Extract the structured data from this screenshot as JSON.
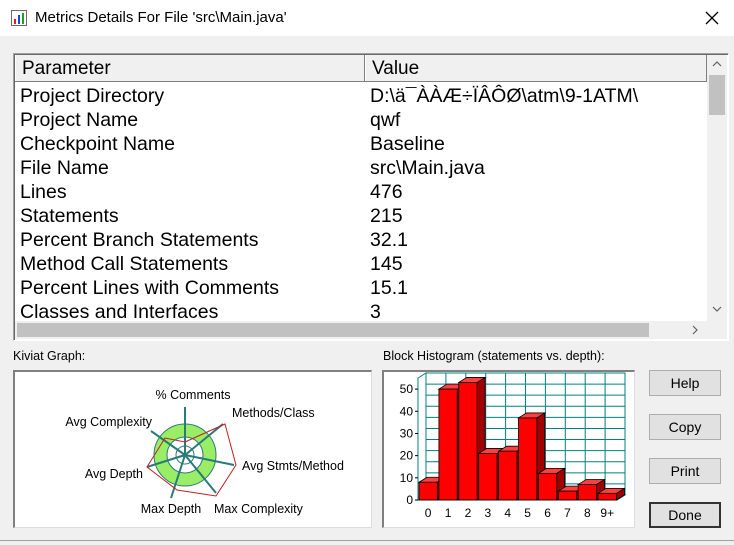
{
  "window": {
    "title": "Metrics Details For File 'src\\Main.java'",
    "close_icon": "close-icon"
  },
  "table": {
    "headers": [
      "Parameter",
      "Value"
    ],
    "rows": [
      {
        "param": "Project Directory",
        "value": "D:\\ä¯ÀÀÆ÷ÏÂÔØ\\atm\\9-1ATM\\"
      },
      {
        "param": "Project Name",
        "value": "qwf"
      },
      {
        "param": "Checkpoint Name",
        "value": "Baseline"
      },
      {
        "param": "File Name",
        "value": "src\\Main.java"
      },
      {
        "param": "Lines",
        "value": "476"
      },
      {
        "param": "Statements",
        "value": "215"
      },
      {
        "param": "Percent Branch Statements",
        "value": "32.1"
      },
      {
        "param": "Method Call Statements",
        "value": "145"
      },
      {
        "param": "Percent Lines with Comments",
        "value": "15.1"
      },
      {
        "param": "Classes and Interfaces",
        "value": "3"
      }
    ]
  },
  "kiviat": {
    "label": "Kiviat Graph:",
    "axes": [
      "% Comments",
      "Methods/Class",
      "Avg Stmts/Method",
      "Max Complexity",
      "Max Depth",
      "Avg Depth",
      "Avg Complexity"
    ]
  },
  "histogram": {
    "label": "Block Histogram (statements vs. depth):",
    "bar_color": "#ff0000",
    "grid_color": "#008080"
  },
  "chart_data": {
    "type": "bar",
    "categories": [
      "0",
      "1",
      "2",
      "3",
      "4",
      "5",
      "6",
      "7",
      "8",
      "9+"
    ],
    "values": [
      8,
      50,
      53,
      21,
      22,
      37,
      12,
      4,
      7,
      3
    ],
    "ylim": [
      0,
      55
    ],
    "yticks": [
      "0",
      "10",
      "20",
      "30",
      "40",
      "50"
    ]
  },
  "buttons": {
    "help": "Help",
    "copy": "Copy",
    "print": "Print",
    "done": "Done"
  }
}
